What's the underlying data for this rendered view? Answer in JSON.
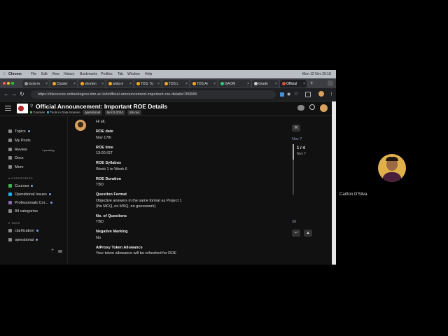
{
  "menubar": {
    "items": [
      "Chrome",
      "File",
      "Edit",
      "View",
      "History",
      "Bookmarks",
      "Profiles",
      "Tab",
      "Window",
      "Help"
    ],
    "clock": "Mon 12 Nov 20:18"
  },
  "tabs": [
    {
      "label": "tools-in",
      "color": "#999"
    },
    {
      "label": "Cluster",
      "color": "#f5a623"
    },
    {
      "label": "shorten",
      "color": "#f5a623"
    },
    {
      "label": "anka-n",
      "color": "#f5a623"
    },
    {
      "label": "TDS: To",
      "color": "#f5a623"
    },
    {
      "label": "TDS L",
      "color": "#f5a623"
    },
    {
      "label": "TDS Ar",
      "color": "#f5a623"
    },
    {
      "label": "GAOM",
      "color": "#2ecc71"
    },
    {
      "label": "Grade",
      "color": "#ccc"
    },
    {
      "label": "Official",
      "color": "#e74c3c"
    }
  ],
  "address": {
    "url": "https://discourse.onlinedegree.iitm.ac.in/t/official-announcement-important-roe-details/156848"
  },
  "topic": {
    "title": "Official Announcement: Important ROE Details",
    "category1": "Courses",
    "category2": "Tools in Data Science",
    "tags": [
      "operational",
      "term3-2024",
      "tds-roe"
    ]
  },
  "sidebar": {
    "items": [
      {
        "label": "Topics"
      },
      {
        "label": "My Posts"
      },
      {
        "label": "Review",
        "badge": "1 pending"
      },
      {
        "label": "Docs"
      },
      {
        "label": "More"
      }
    ],
    "categories_title": "CATEGORIES",
    "categories": [
      {
        "label": "Courses",
        "color": "#3ab54a"
      },
      {
        "label": "Operational Issues",
        "color": "#25aae1"
      },
      {
        "label": "Professionals Cor...",
        "color": "#8c6bb1"
      },
      {
        "label": "All categories",
        "color": "#888"
      }
    ],
    "tags_title": "TAGS",
    "tags": [
      {
        "label": "clarification"
      },
      {
        "label": "operational"
      }
    ]
  },
  "post": {
    "greeting": "Hi all,",
    "sections": [
      {
        "label": "ROE date",
        "lines": [
          "Nov 17th"
        ]
      },
      {
        "label": "ROE time",
        "lines": [
          "13:00 IST"
        ]
      },
      {
        "label": "ROE Syllabus",
        "lines": [
          "Week 1 to Week 6"
        ]
      },
      {
        "label": "ROE Duration",
        "lines": [
          "TBD"
        ]
      },
      {
        "label": "Question Format",
        "lines": [
          "Objective answers in the same format as Project 1",
          "(No MCQ, no MSQ, no guesswork)"
        ]
      },
      {
        "label": "No. of Questions",
        "lines": [
          "TBD"
        ]
      },
      {
        "label": "Negative Marking",
        "lines": [
          "No"
        ]
      },
      {
        "label": "AIProxy Token Allowance",
        "lines": [
          "Your token allowance will be refreshed for ROE"
        ]
      }
    ]
  },
  "timeline": {
    "top_date": "Nov 7",
    "position": "1 / 4",
    "position_date": "Nov 7",
    "bottom": "3d"
  },
  "participant": {
    "name": "Carlton D'Silva"
  }
}
